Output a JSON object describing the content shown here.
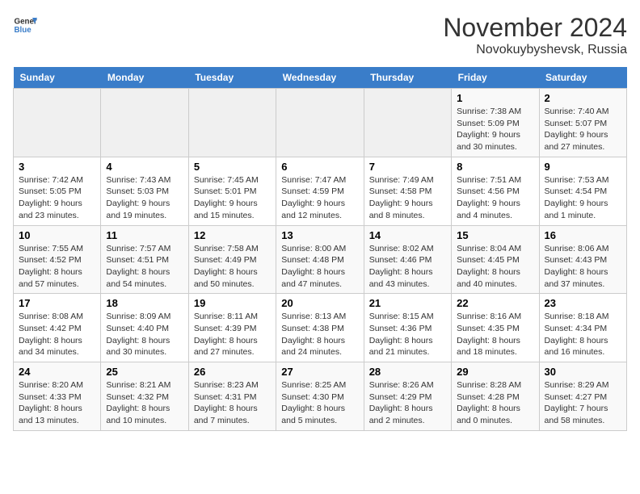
{
  "logo": {
    "general": "General",
    "blue": "Blue"
  },
  "header": {
    "title": "November 2024",
    "subtitle": "Novokuybyshevsk, Russia"
  },
  "weekdays": [
    "Sunday",
    "Monday",
    "Tuesday",
    "Wednesday",
    "Thursday",
    "Friday",
    "Saturday"
  ],
  "weeks": [
    [
      {
        "day": "",
        "empty": true
      },
      {
        "day": "",
        "empty": true
      },
      {
        "day": "",
        "empty": true
      },
      {
        "day": "",
        "empty": true
      },
      {
        "day": "",
        "empty": true
      },
      {
        "day": "1",
        "sunrise": "Sunrise: 7:38 AM",
        "sunset": "Sunset: 5:09 PM",
        "daylight": "Daylight: 9 hours and 30 minutes."
      },
      {
        "day": "2",
        "sunrise": "Sunrise: 7:40 AM",
        "sunset": "Sunset: 5:07 PM",
        "daylight": "Daylight: 9 hours and 27 minutes."
      }
    ],
    [
      {
        "day": "3",
        "sunrise": "Sunrise: 7:42 AM",
        "sunset": "Sunset: 5:05 PM",
        "daylight": "Daylight: 9 hours and 23 minutes."
      },
      {
        "day": "4",
        "sunrise": "Sunrise: 7:43 AM",
        "sunset": "Sunset: 5:03 PM",
        "daylight": "Daylight: 9 hours and 19 minutes."
      },
      {
        "day": "5",
        "sunrise": "Sunrise: 7:45 AM",
        "sunset": "Sunset: 5:01 PM",
        "daylight": "Daylight: 9 hours and 15 minutes."
      },
      {
        "day": "6",
        "sunrise": "Sunrise: 7:47 AM",
        "sunset": "Sunset: 4:59 PM",
        "daylight": "Daylight: 9 hours and 12 minutes."
      },
      {
        "day": "7",
        "sunrise": "Sunrise: 7:49 AM",
        "sunset": "Sunset: 4:58 PM",
        "daylight": "Daylight: 9 hours and 8 minutes."
      },
      {
        "day": "8",
        "sunrise": "Sunrise: 7:51 AM",
        "sunset": "Sunset: 4:56 PM",
        "daylight": "Daylight: 9 hours and 4 minutes."
      },
      {
        "day": "9",
        "sunrise": "Sunrise: 7:53 AM",
        "sunset": "Sunset: 4:54 PM",
        "daylight": "Daylight: 9 hours and 1 minute."
      }
    ],
    [
      {
        "day": "10",
        "sunrise": "Sunrise: 7:55 AM",
        "sunset": "Sunset: 4:52 PM",
        "daylight": "Daylight: 8 hours and 57 minutes."
      },
      {
        "day": "11",
        "sunrise": "Sunrise: 7:57 AM",
        "sunset": "Sunset: 4:51 PM",
        "daylight": "Daylight: 8 hours and 54 minutes."
      },
      {
        "day": "12",
        "sunrise": "Sunrise: 7:58 AM",
        "sunset": "Sunset: 4:49 PM",
        "daylight": "Daylight: 8 hours and 50 minutes."
      },
      {
        "day": "13",
        "sunrise": "Sunrise: 8:00 AM",
        "sunset": "Sunset: 4:48 PM",
        "daylight": "Daylight: 8 hours and 47 minutes."
      },
      {
        "day": "14",
        "sunrise": "Sunrise: 8:02 AM",
        "sunset": "Sunset: 4:46 PM",
        "daylight": "Daylight: 8 hours and 43 minutes."
      },
      {
        "day": "15",
        "sunrise": "Sunrise: 8:04 AM",
        "sunset": "Sunset: 4:45 PM",
        "daylight": "Daylight: 8 hours and 40 minutes."
      },
      {
        "day": "16",
        "sunrise": "Sunrise: 8:06 AM",
        "sunset": "Sunset: 4:43 PM",
        "daylight": "Daylight: 8 hours and 37 minutes."
      }
    ],
    [
      {
        "day": "17",
        "sunrise": "Sunrise: 8:08 AM",
        "sunset": "Sunset: 4:42 PM",
        "daylight": "Daylight: 8 hours and 34 minutes."
      },
      {
        "day": "18",
        "sunrise": "Sunrise: 8:09 AM",
        "sunset": "Sunset: 4:40 PM",
        "daylight": "Daylight: 8 hours and 30 minutes."
      },
      {
        "day": "19",
        "sunrise": "Sunrise: 8:11 AM",
        "sunset": "Sunset: 4:39 PM",
        "daylight": "Daylight: 8 hours and 27 minutes."
      },
      {
        "day": "20",
        "sunrise": "Sunrise: 8:13 AM",
        "sunset": "Sunset: 4:38 PM",
        "daylight": "Daylight: 8 hours and 24 minutes."
      },
      {
        "day": "21",
        "sunrise": "Sunrise: 8:15 AM",
        "sunset": "Sunset: 4:36 PM",
        "daylight": "Daylight: 8 hours and 21 minutes."
      },
      {
        "day": "22",
        "sunrise": "Sunrise: 8:16 AM",
        "sunset": "Sunset: 4:35 PM",
        "daylight": "Daylight: 8 hours and 18 minutes."
      },
      {
        "day": "23",
        "sunrise": "Sunrise: 8:18 AM",
        "sunset": "Sunset: 4:34 PM",
        "daylight": "Daylight: 8 hours and 16 minutes."
      }
    ],
    [
      {
        "day": "24",
        "sunrise": "Sunrise: 8:20 AM",
        "sunset": "Sunset: 4:33 PM",
        "daylight": "Daylight: 8 hours and 13 minutes."
      },
      {
        "day": "25",
        "sunrise": "Sunrise: 8:21 AM",
        "sunset": "Sunset: 4:32 PM",
        "daylight": "Daylight: 8 hours and 10 minutes."
      },
      {
        "day": "26",
        "sunrise": "Sunrise: 8:23 AM",
        "sunset": "Sunset: 4:31 PM",
        "daylight": "Daylight: 8 hours and 7 minutes."
      },
      {
        "day": "27",
        "sunrise": "Sunrise: 8:25 AM",
        "sunset": "Sunset: 4:30 PM",
        "daylight": "Daylight: 8 hours and 5 minutes."
      },
      {
        "day": "28",
        "sunrise": "Sunrise: 8:26 AM",
        "sunset": "Sunset: 4:29 PM",
        "daylight": "Daylight: 8 hours and 2 minutes."
      },
      {
        "day": "29",
        "sunrise": "Sunrise: 8:28 AM",
        "sunset": "Sunset: 4:28 PM",
        "daylight": "Daylight: 8 hours and 0 minutes."
      },
      {
        "day": "30",
        "sunrise": "Sunrise: 8:29 AM",
        "sunset": "Sunset: 4:27 PM",
        "daylight": "Daylight: 7 hours and 58 minutes."
      }
    ]
  ]
}
